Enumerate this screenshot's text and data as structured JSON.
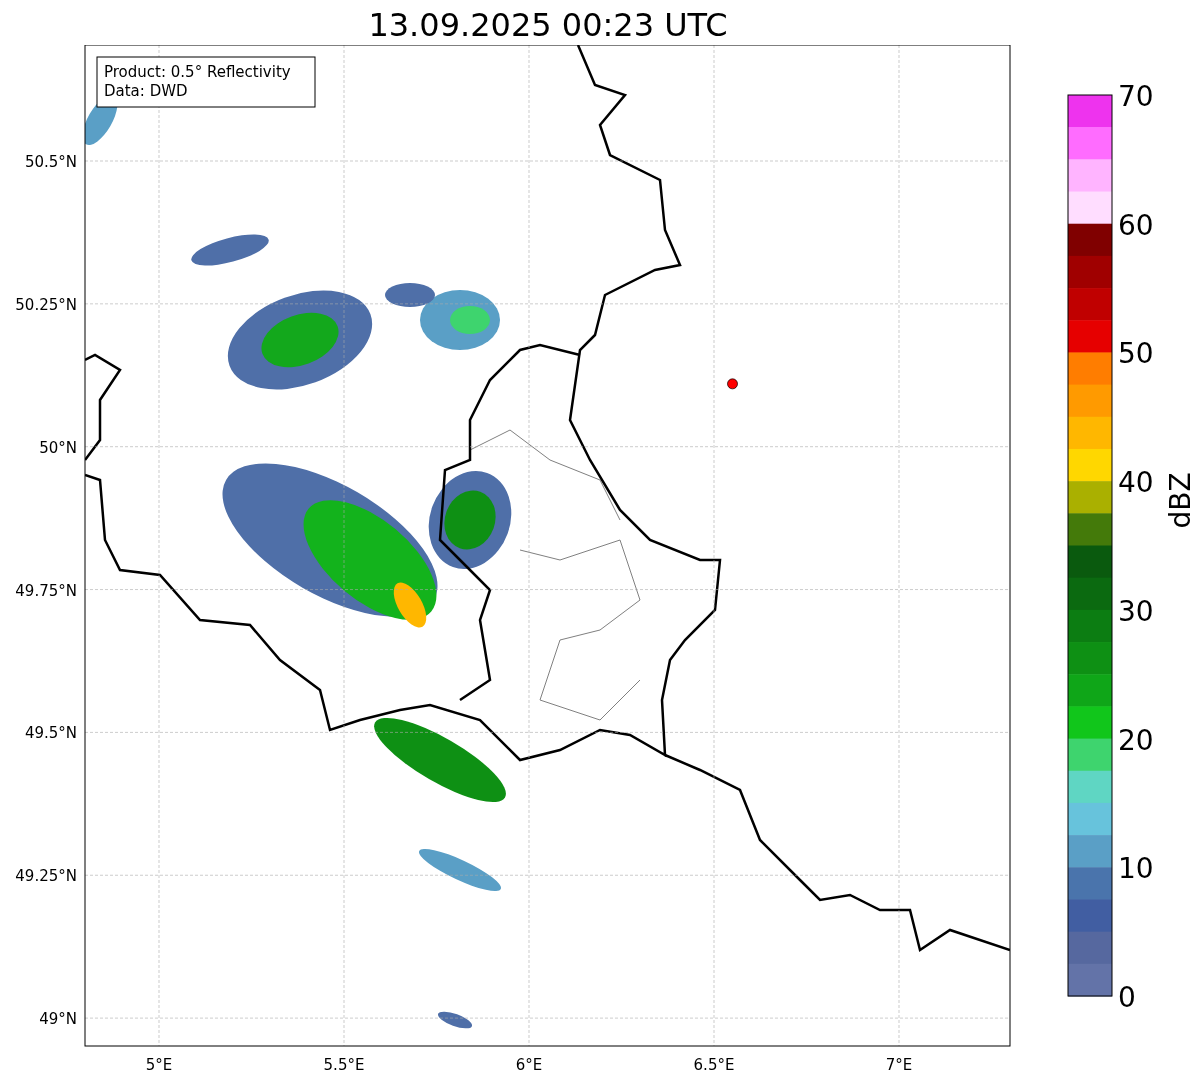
{
  "title": "13.09.2025 00:23 UTC",
  "info_box": {
    "lines": [
      "Product: 0.5° Reflectivity",
      "Data: DWD"
    ]
  },
  "map": {
    "lat_ticks": [
      "50.5°N",
      "50.25°N",
      "50°N",
      "49.75°N",
      "49.5°N",
      "49.25°N",
      "49°N"
    ],
    "lon_ticks": [
      "5°E",
      "5.5°E",
      "6°E",
      "6.5°E",
      "7°E"
    ]
  },
  "colorbar": {
    "label": "dBZ",
    "ticks": [
      "70",
      "60",
      "50",
      "40",
      "30",
      "20",
      "10",
      "0"
    ],
    "bins": [
      {
        "color": "#ee33ee"
      },
      {
        "color": "#ff6cff"
      },
      {
        "color": "#ffb4ff"
      },
      {
        "color": "#ffddff"
      },
      {
        "color": "#800000"
      },
      {
        "color": "#a00000"
      },
      {
        "color": "#c00000"
      },
      {
        "color": "#e60000"
      },
      {
        "color": "#ff7d00"
      },
      {
        "color": "#ff9a00"
      },
      {
        "color": "#ffb700"
      },
      {
        "color": "#ffd700"
      },
      {
        "color": "#aab000"
      },
      {
        "color": "#447a0a"
      },
      {
        "color": "#0a5a0e"
      },
      {
        "color": "#0b6a10"
      },
      {
        "color": "#0c7d12"
      },
      {
        "color": "#0e9014"
      },
      {
        "color": "#0fa618"
      },
      {
        "color": "#11c61b"
      },
      {
        "color": "#3ed46e"
      },
      {
        "color": "#5fd6c3"
      },
      {
        "color": "#67c3dc"
      },
      {
        "color": "#5a9fc6"
      },
      {
        "color": "#4a74ac"
      },
      {
        "color": "#415ea2"
      },
      {
        "color": "#56689f"
      },
      {
        "color": "#6373a8"
      }
    ]
  }
}
